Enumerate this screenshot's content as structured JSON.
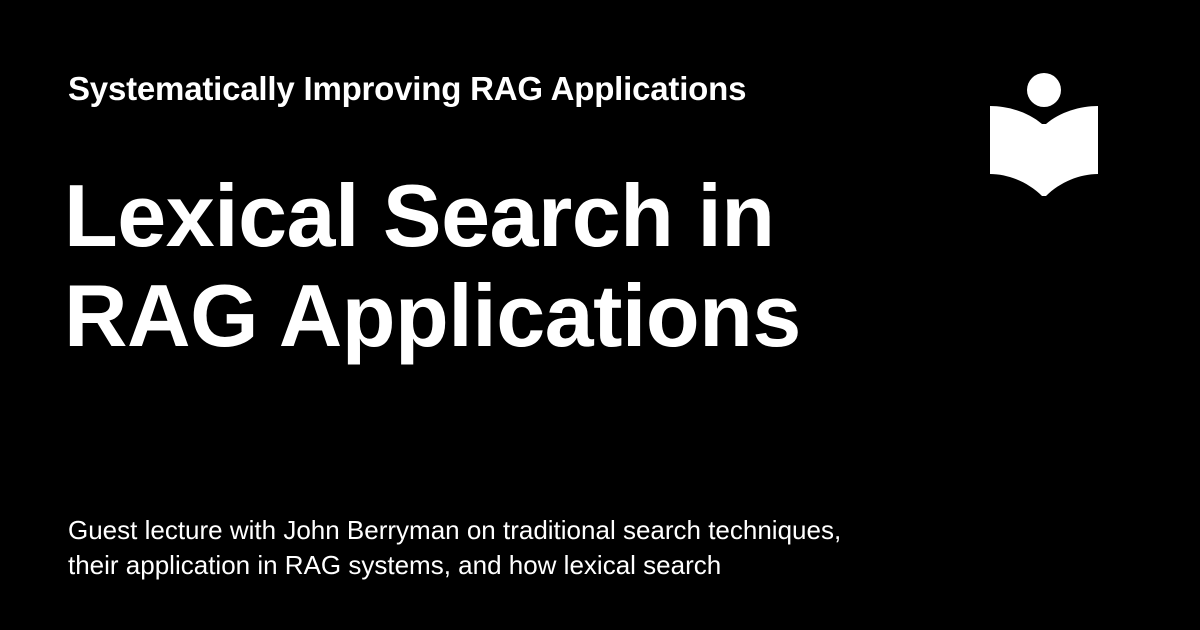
{
  "header": {
    "site_name": "Systematically Improving RAG Applications",
    "logo_icon": "reading-book-icon"
  },
  "main": {
    "title_lines": [
      "Lexical Search in",
      "RAG Applications"
    ],
    "description_lines": [
      "Guest lecture with John Berryman on traditional search techniques,",
      "their application in RAG systems, and how lexical search"
    ]
  },
  "colors": {
    "background": "#000000",
    "foreground": "#ffffff"
  }
}
